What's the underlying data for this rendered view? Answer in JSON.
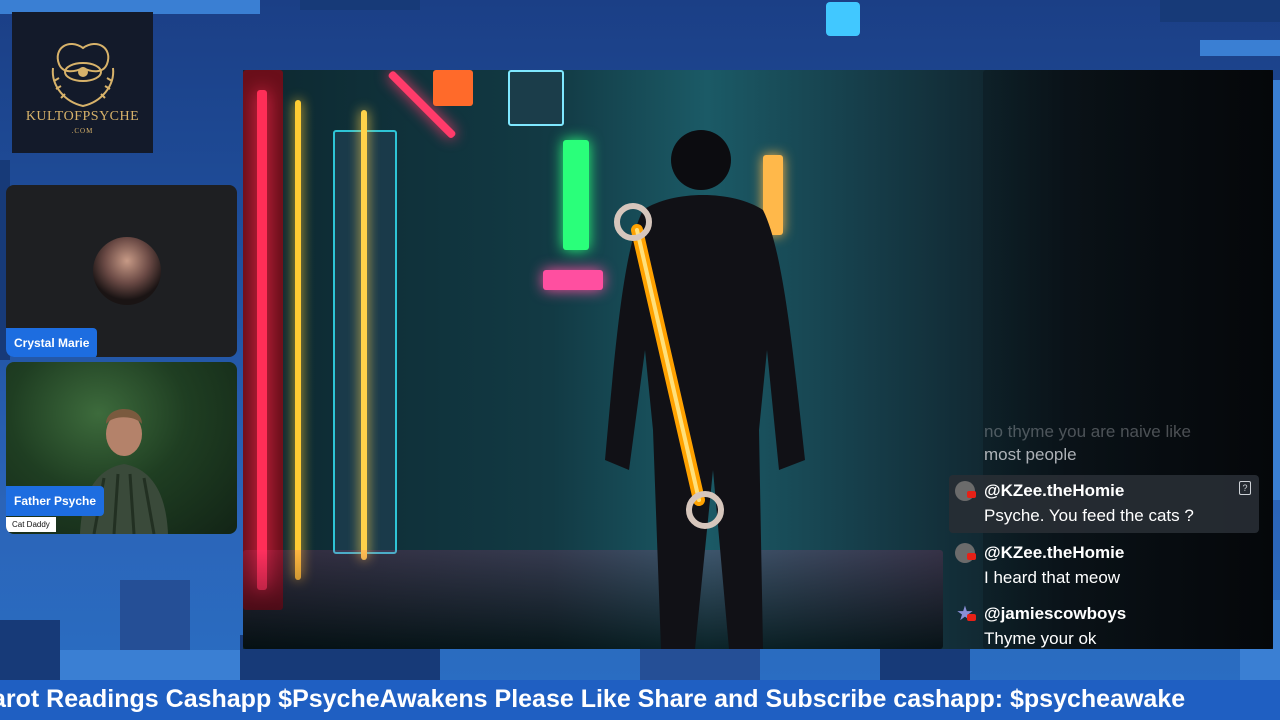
{
  "logo": {
    "text": "KULTOFPSYCHE",
    "sub": ".COM",
    "icon": "eye-butterfly-icon"
  },
  "participants": [
    {
      "name": "Crystal Marie",
      "sub_label": ""
    },
    {
      "name": "Father Psyche",
      "sub_label": "Cat Daddy"
    }
  ],
  "chat": {
    "faded_lines": [
      "no thyme you are naive like",
      "most people"
    ],
    "messages": [
      {
        "user": "@KZee.theHomie",
        "text": "Psyche. You feed the cats ?",
        "avatar": "user-avatar-icon"
      },
      {
        "user": "@KZee.theHomie",
        "text": "I heard that meow",
        "avatar": "user-avatar-icon"
      },
      {
        "user": "@jamiescowboys",
        "text": "Thyme your ok",
        "avatar": "star-avatar-icon"
      }
    ]
  },
  "ticker": {
    "text": "arot Readings Cashapp $PsycheAwakens Please Like Share and Subscribe cashapp: $psycheawake"
  },
  "colors": {
    "ticker_bg": "#1f5fc2",
    "name_tag_bg": "#1d6de0",
    "logo_gold": "#d7b26a",
    "youtube_red": "#e62117"
  }
}
